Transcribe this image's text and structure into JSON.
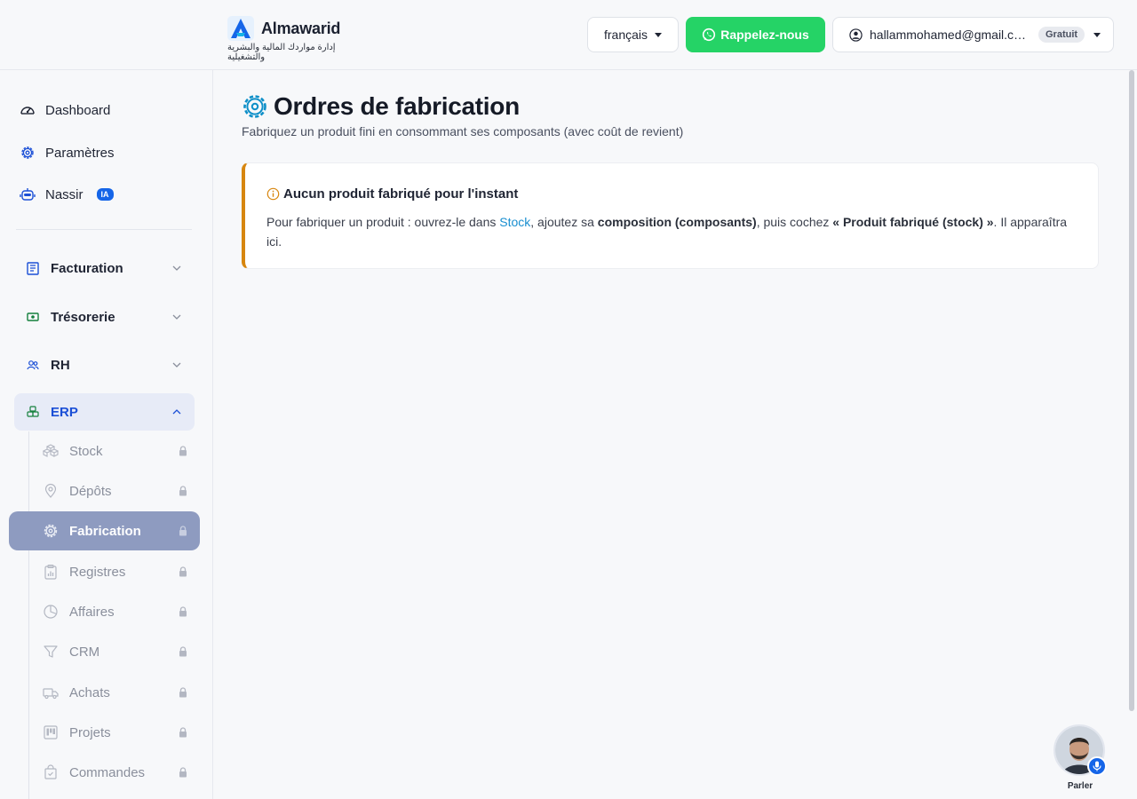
{
  "brand": {
    "name": "Almawarid",
    "tagline": "إدارة مواردك المالية والبشرية والتشغيلية"
  },
  "header": {
    "language": "français",
    "callback_label": "Rappelez-nous",
    "user_email": "hallammohamed@gmail.c…",
    "plan_badge": "Gratuit"
  },
  "sidebar": {
    "top_items": [
      {
        "label": "Dashboard",
        "icon": "gauge-icon"
      },
      {
        "label": "Paramètres",
        "icon": "gear-icon"
      },
      {
        "label": "Nassir",
        "icon": "robot-icon",
        "badge": "IA"
      }
    ],
    "sections": [
      {
        "label": "Facturation",
        "icon": "invoice-icon"
      },
      {
        "label": "Trésorerie",
        "icon": "cash-icon"
      },
      {
        "label": "RH",
        "icon": "users-icon"
      },
      {
        "label": "ERP",
        "icon": "cubes-icon",
        "expanded": true
      }
    ],
    "erp_items": [
      {
        "label": "Stock",
        "icon": "boxes-icon"
      },
      {
        "label": "Dépôts",
        "icon": "map-pin-icon"
      },
      {
        "label": "Fabrication",
        "icon": "gear-icon",
        "active": true
      },
      {
        "label": "Registres",
        "icon": "clipboard-chart-icon"
      },
      {
        "label": "Affaires",
        "icon": "pie-chart-icon"
      },
      {
        "label": "CRM",
        "icon": "filter-icon"
      },
      {
        "label": "Achats",
        "icon": "truck-icon"
      },
      {
        "label": "Projets",
        "icon": "kanban-icon"
      },
      {
        "label": "Commandes",
        "icon": "bag-check-icon"
      }
    ]
  },
  "main": {
    "title": "Ordres de fabrication",
    "subtitle": "Fabriquez un produit fini en consommant ses composants (avec coût de revient)",
    "alert": {
      "title": "Aucun produit fabriqué pour l'instant",
      "text_before": "Pour fabriquer un produit : ouvrez-le dans ",
      "link": "Stock",
      "text_mid": ", ajoutez sa ",
      "bold_1": "composition (composants)",
      "text_mid2": ", puis cochez ",
      "bold_2": "« Produit fabriqué (stock) »",
      "text_after": ". Il apparaîtra ici."
    }
  },
  "voice": {
    "label": "Parler"
  },
  "colors": {
    "accent": "#1565e8",
    "whatsapp": "#25d366",
    "warning": "#d7860f",
    "active_item": "#8e9bc0"
  }
}
